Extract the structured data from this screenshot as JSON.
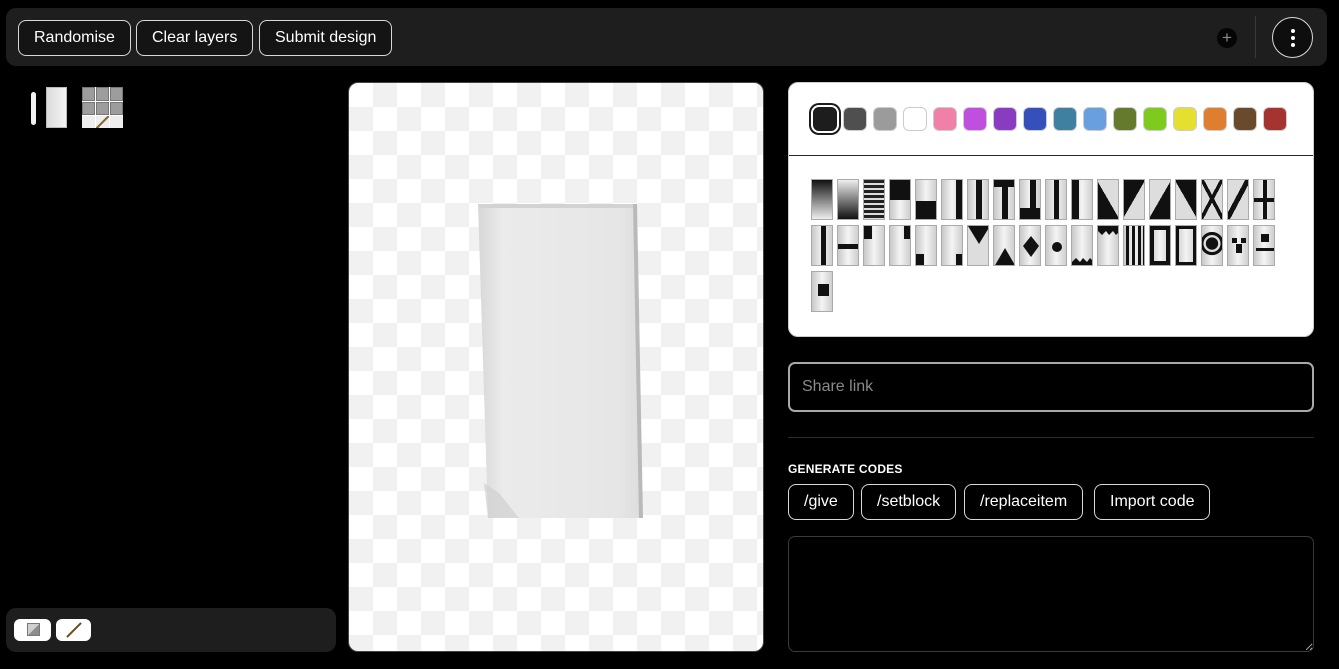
{
  "toolbar": {
    "randomise_label": "Randomise",
    "clear_label": "Clear layers",
    "submit_label": "Submit design",
    "add_icon": "plus-circle-icon",
    "menu_icon": "vertical-dots-icon"
  },
  "palette": {
    "colors": [
      "#1d1d1d",
      "#4f4f4f",
      "#9b9b9b",
      "#ffffff",
      "#f080a8",
      "#c04fe0",
      "#8a3cc0",
      "#3550bb",
      "#3f7f9f",
      "#6a9fdf",
      "#667a2e",
      "#7ecb1e",
      "#e5e02f",
      "#e07e30",
      "#6a4a2c",
      "#a53330"
    ],
    "selected_index": 0
  },
  "patterns": {
    "names": [
      "gradient-down",
      "gradient-up",
      "bricks",
      "half-horizontal",
      "half-horizontal-bottom",
      "stripe-right",
      "stripe-center",
      "half-top-stripe",
      "stripe-bottom",
      "stripe-left-pale",
      "stripe-left",
      "diagonal-right",
      "diagonal-left",
      "diagonal-up",
      "diagonal-down",
      "cross",
      "stripe-downright",
      "straight-cross",
      "stripe-middle",
      "stripe-horizontal",
      "square-top-left",
      "square-top-right",
      "square-bottom-left",
      "square-bottom-right",
      "triangle-top",
      "triangle-bottom",
      "rhombus",
      "circle",
      "triangles-bottom",
      "triangles-top",
      "small-stripes",
      "border",
      "curly-border",
      "flower",
      "creeper",
      "skull",
      "mojang"
    ]
  },
  "share": {
    "placeholder": "Share link"
  },
  "codes": {
    "title": "GENERATE CODES",
    "give_label": "/give",
    "setblock_label": "/setblock",
    "replaceitem_label": "/replaceitem",
    "import_label": "Import code"
  },
  "left_tools": {
    "block_icon": "block-icon",
    "stick_icon": "stick-icon"
  }
}
